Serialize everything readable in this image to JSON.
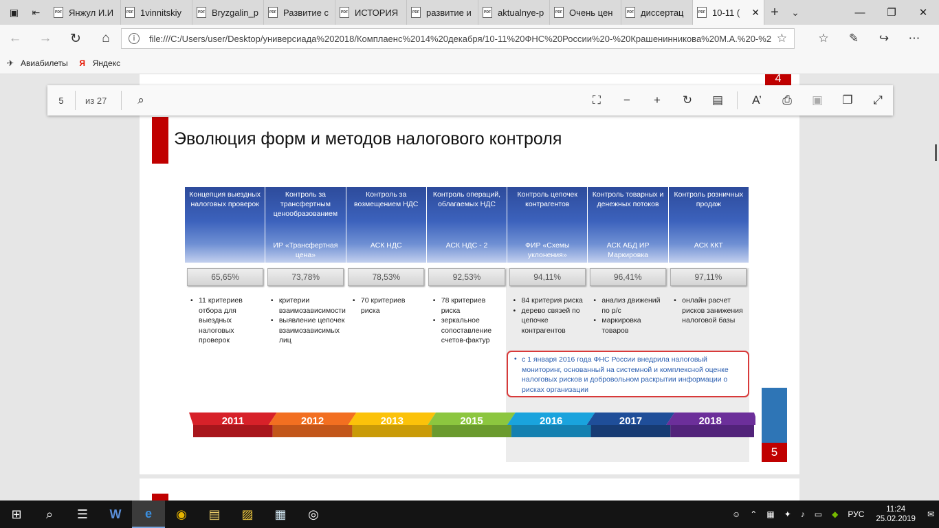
{
  "tabs": [
    {
      "label": "Янжул И.И"
    },
    {
      "label": "1vinnitskiy"
    },
    {
      "label": "Bryzgalin_p"
    },
    {
      "label": "Развитие с"
    },
    {
      "label": "ИСТОРИЯ"
    },
    {
      "label": "развитие и"
    },
    {
      "label": "aktualnye-p"
    },
    {
      "label": "Очень цен"
    },
    {
      "label": "диссертац"
    },
    {
      "label": "10-11 ("
    }
  ],
  "tab_icon_text": "PDF",
  "address": {
    "url": "file:///C:/Users/user/Desktop/универсиада%202018/Комплаенс%2014%20декабря/10-11%20ФНС%20России%20-%20Крашенинникова%20М.А.%20-%20"
  },
  "favorites": [
    {
      "label": "Авиабилеты"
    },
    {
      "label": "Яндекс"
    }
  ],
  "pdf_toolbar": {
    "page_number": "5",
    "page_of": "из 27"
  },
  "slide": {
    "top_page_number": "4",
    "title": "Эволюция форм и методов налогового контроля",
    "columns": [
      {
        "header": "Концепция выездных налоговых проверок",
        "system": "",
        "percent": "65,65%",
        "bullets": [
          "11 критериев отбора для выездных налоговых проверок"
        ]
      },
      {
        "header": "Контроль за трансфертным ценообразованием",
        "system": "ИР «Трансфертная цена»",
        "percent": "73,78%",
        "bullets": [
          "критерии взаимозависимости",
          "выявление цепочек взаимозависимых лиц"
        ]
      },
      {
        "header": "Контроль за возмещением НДС",
        "system": "АСК НДС",
        "percent": "78,53%",
        "bullets": [
          "70 критериев риска"
        ]
      },
      {
        "header": "Контроль операций, облагаемых НДС",
        "system": "АСК НДС - 2",
        "percent": "92,53%",
        "bullets": [
          "78 критериев риска",
          "зеркальное сопоставление счетов-фактур"
        ]
      },
      {
        "header": "Контроль цепочек контрагентов",
        "system": "ФИР «Схемы уклонения»",
        "percent": "94,11%",
        "bullets": [
          "84 критерия риска",
          "дерево связей по цепочке контрагентов"
        ]
      },
      {
        "header": "Контроль товарных и денежных потоков",
        "system": "АСК АБД ИР Маркировка",
        "percent": "96,41%",
        "bullets": [
          "анализ движений по р/с",
          "маркировка товаров"
        ]
      },
      {
        "header": "Контроль розничных продаж",
        "system": "АСК ККТ",
        "percent": "97,11%",
        "bullets": [
          "онлайн расчет рисков занижения налоговой базы"
        ]
      }
    ],
    "note": "с 1 января 2016 года ФНС России внедрила налоговый мониторинг, основанный на системной и комплексной оценке налоговых рисков и добровольном раскрытии информации о рисках организации",
    "timeline": [
      {
        "year": "2011",
        "color": "#d72129",
        "dark": "#a8161c"
      },
      {
        "year": "2012",
        "color": "#f26f21",
        "dark": "#c2561a"
      },
      {
        "year": "2013",
        "color": "#fbc20a",
        "dark": "#c99b08"
      },
      {
        "year": "2015",
        "color": "#8cc63f",
        "dark": "#6a9a2e"
      },
      {
        "year": "2016",
        "color": "#1aa3dd",
        "dark": "#1480b0"
      },
      {
        "year": "2017",
        "color": "#1f4e99",
        "dark": "#173b73"
      },
      {
        "year": "2018",
        "color": "#6c2f9a",
        "dark": "#52237a"
      }
    ],
    "bottom_page_number": "5"
  },
  "taskbar": {
    "language": "РУС",
    "time": "11:24",
    "date": "25.02.2019"
  }
}
